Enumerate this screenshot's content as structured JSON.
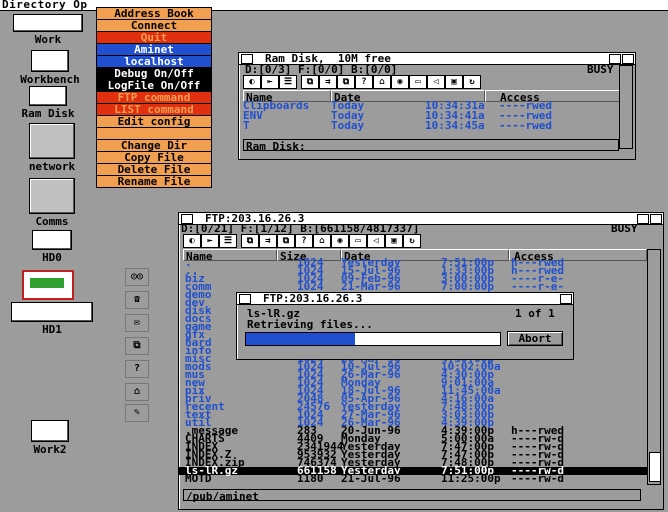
{
  "screen": {
    "title": "Directory Op"
  },
  "desktop_icons": [
    {
      "label": "Work"
    },
    {
      "label": "Workbench"
    },
    {
      "label": "Ram Disk"
    },
    {
      "label": "network"
    },
    {
      "label": "Comms"
    },
    {
      "label": "HD0"
    },
    {
      "label": "HD1"
    },
    {
      "label": "Work2"
    }
  ],
  "menu": [
    {
      "label": "Address Book",
      "style": "orange"
    },
    {
      "label": "Connect",
      "style": "orange"
    },
    {
      "label": "Quit",
      "style": "red"
    },
    {
      "label": "Aminet",
      "style": "blue"
    },
    {
      "label": "localhost",
      "style": "blue"
    },
    {
      "label": "Debug On/Off",
      "style": "blk"
    },
    {
      "label": "LogFile On/Off",
      "style": "blk"
    },
    {
      "label": "FTP command",
      "style": "red"
    },
    {
      "label": "LIST command",
      "style": "red"
    },
    {
      "label": "Edit config",
      "style": "orange"
    },
    {
      "label": "",
      "style": "orange"
    },
    {
      "label": "Change Dir",
      "style": "orange"
    },
    {
      "label": "Copy File",
      "style": "orange"
    },
    {
      "label": "Delete File",
      "style": "orange"
    },
    {
      "label": "Rename File",
      "style": "orange"
    }
  ],
  "ram_window": {
    "title": "Ram Disk,  10M free",
    "busy": "BUSY",
    "status": "D:[0/3] F:[0/0] B:[0/0]",
    "headers": [
      "Name",
      "Date",
      "Access"
    ],
    "rows": [
      {
        "name": "Clipboards",
        "date": "Today",
        "time": "10:34:31a",
        "access": "----rwed"
      },
      {
        "name": "ENV",
        "date": "Today",
        "time": "10:34:41a",
        "access": "----rwed"
      },
      {
        "name": "T",
        "date": "Today",
        "time": "10:34:45a",
        "access": "----rwed"
      }
    ],
    "path": "Ram Disk:"
  },
  "ftp_window": {
    "title": "FTP:203.16.26.3",
    "status": "D:[0/21] F:[1/12] B:[661158/4817337]",
    "busy": "BUSY",
    "headers": [
      "Name",
      "Size",
      "Date",
      "Access"
    ],
    "rows": [
      {
        "name": ".",
        "size": "1024",
        "date": "Yesterday",
        "time": "7:51:00p",
        "access": "h---rwed",
        "c": "b"
      },
      {
        "name": "..",
        "size": "1024",
        "date": "15-Jul-96",
        "time": "1:33:00p",
        "access": "h---rwed",
        "c": "b"
      },
      {
        "name": "biz",
        "size": "1024",
        "date": "09-Feb-96",
        "time": "3:00:00p",
        "access": "----r-e-",
        "c": "b"
      },
      {
        "name": "comm",
        "size": "1024",
        "date": "21-Mar-96",
        "time": "7:00:00p",
        "access": "----r-e-",
        "c": "b"
      },
      {
        "name": "demo",
        "size": "",
        "date": "",
        "time": "",
        "access": "",
        "c": "b"
      },
      {
        "name": "dev",
        "size": "",
        "date": "",
        "time": "",
        "access": "",
        "c": "b"
      },
      {
        "name": "disk",
        "size": "",
        "date": "",
        "time": "",
        "access": "",
        "c": "b"
      },
      {
        "name": "docs",
        "size": "",
        "date": "",
        "time": "",
        "access": "",
        "c": "b"
      },
      {
        "name": "game",
        "size": "",
        "date": "",
        "time": "",
        "access": "",
        "c": "b"
      },
      {
        "name": "gfx",
        "size": "",
        "date": "",
        "time": "",
        "access": "",
        "c": "b"
      },
      {
        "name": "hard",
        "size": "",
        "date": "",
        "time": "",
        "access": "",
        "c": "b"
      },
      {
        "name": "info",
        "size": "",
        "date": "",
        "time": "",
        "access": "",
        "c": "b"
      },
      {
        "name": "misc",
        "size": "1024",
        "date": "26-Mar-96",
        "time": "4:30:00p",
        "access": "",
        "c": "b"
      },
      {
        "name": "mods",
        "size": "1024",
        "date": "10-Jul-96",
        "time": "10:02:00a",
        "access": "",
        "c": "b"
      },
      {
        "name": "mus",
        "size": "1024",
        "date": "26-Mar-96",
        "time": "4:30:00p",
        "access": "",
        "c": "b"
      },
      {
        "name": "new",
        "size": "1024",
        "date": "Monday",
        "time": "9:01:00a",
        "access": "",
        "c": "b"
      },
      {
        "name": "pix",
        "size": "1024",
        "date": "18-Jul-96",
        "time": "11:45:00a",
        "access": "",
        "c": "b"
      },
      {
        "name": "priv",
        "size": "2048",
        "date": "05-Apr-96",
        "time": "4:16:00a",
        "access": "",
        "c": "b"
      },
      {
        "name": "recent",
        "size": "24576",
        "date": "Yesterday",
        "time": "7:48:00p",
        "access": "",
        "c": "b"
      },
      {
        "name": "text",
        "size": "1024",
        "date": "27-Mar-96",
        "time": "3:03:00p",
        "access": "",
        "c": "b"
      },
      {
        "name": "util",
        "size": "1024",
        "date": "26-Mar-96",
        "time": "4:39:00p",
        "access": "",
        "c": "b"
      },
      {
        "name": ".message",
        "size": "283",
        "date": "20-Jun-96",
        "time": "4:39:00p",
        "access": "h---rwed",
        "c": "k"
      },
      {
        "name": "CHARTS",
        "size": "4409",
        "date": "Monday",
        "time": "5:00:00a",
        "access": "----rw-d",
        "c": "k"
      },
      {
        "name": "INDEX",
        "size": "2341944",
        "date": "Yesterday",
        "time": "7:47:00p",
        "access": "----rw-d",
        "c": "k"
      },
      {
        "name": "INDEX.Z",
        "size": "953932",
        "date": "Yesterday",
        "time": "7:47:00p",
        "access": "----rw-d",
        "c": "k"
      },
      {
        "name": "INDEX.zip",
        "size": "746374",
        "date": "Yesterday",
        "time": "7:48:00p",
        "access": "----rw-d",
        "c": "k"
      },
      {
        "name": "ls-lR.gz",
        "size": "661158",
        "date": "Yesterday",
        "time": "7:51:00p",
        "access": "----rw-d",
        "c": "sel"
      },
      {
        "name": "MOTD",
        "size": "1180",
        "date": "21-Jul-96",
        "time": "11:25:00p",
        "access": "----rw-d",
        "c": "k"
      }
    ],
    "path": "/pub/aminet"
  },
  "transfer_dialog": {
    "title": "FTP:203.16.26.3",
    "file": "ls-lR.gz",
    "counter": "1 of 1",
    "message": "Retrieving files...",
    "progress": 0.43,
    "abort": "Abort"
  },
  "colors": {
    "blue": "#2050d0",
    "orange": "#f0a050",
    "red": "#e03010",
    "grey": "#9c9c9c"
  }
}
